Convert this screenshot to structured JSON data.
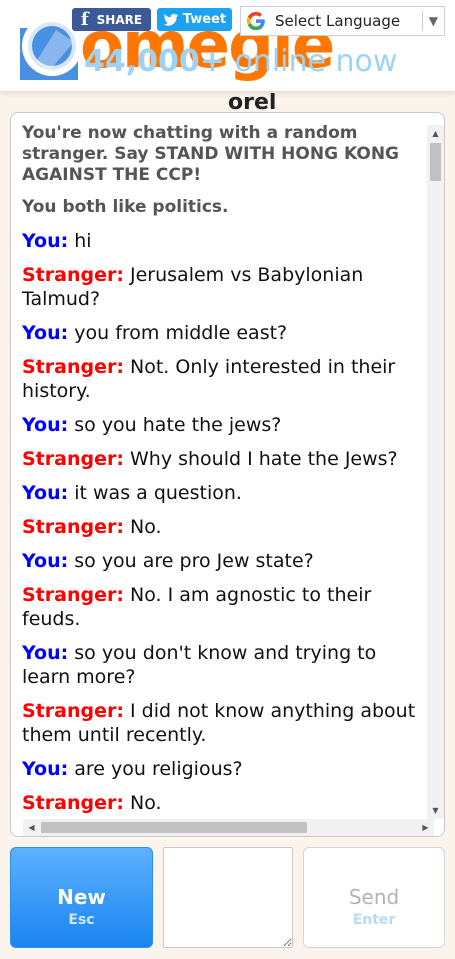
{
  "header": {
    "logo_text": "omegle",
    "online_count": "44,000+",
    "online_label": "online now",
    "share_label": "SHARE",
    "tweet_label": "Tweet",
    "language_select": "Select Language"
  },
  "peek_text": "orel",
  "chat": {
    "system_messages": [
      "You're now chatting with a random stranger. Say STAND WITH HONG KONG AGAINST THE CCP!",
      "You both like politics."
    ],
    "messages": [
      {
        "who": "You:",
        "text": "hi"
      },
      {
        "who": "Stranger:",
        "text": "Jerusalem vs Babylonian Talmud?"
      },
      {
        "who": "You:",
        "text": "you from middle east?"
      },
      {
        "who": "Stranger:",
        "text": "Not. Only interested in their history."
      },
      {
        "who": "You:",
        "text": "so you hate the jews?"
      },
      {
        "who": "Stranger:",
        "text": "Why should I hate the Jews?"
      },
      {
        "who": "You:",
        "text": "it was a question."
      },
      {
        "who": "Stranger:",
        "text": "No."
      },
      {
        "who": "You:",
        "text": "so you are pro Jew state?"
      },
      {
        "who": "Stranger:",
        "text": "No. I am agnostic to their feuds."
      },
      {
        "who": "You:",
        "text": "so you don't know and trying to learn more?"
      },
      {
        "who": "Stranger:",
        "text": "I did not know anything about them until recently."
      },
      {
        "who": "You:",
        "text": "are you religious?"
      },
      {
        "who": "Stranger:",
        "text": "No."
      }
    ]
  },
  "controls": {
    "new_label": "New",
    "new_shortcut": "Esc",
    "send_label": "Send",
    "send_shortcut": "Enter",
    "message_value": ""
  },
  "colors": {
    "brand_orange": "#ff7700",
    "online_blue": "#9fd3f5",
    "you_color": "#0000ff",
    "stranger_color": "#ff0000",
    "new_button_blue": "#1a85f0"
  }
}
